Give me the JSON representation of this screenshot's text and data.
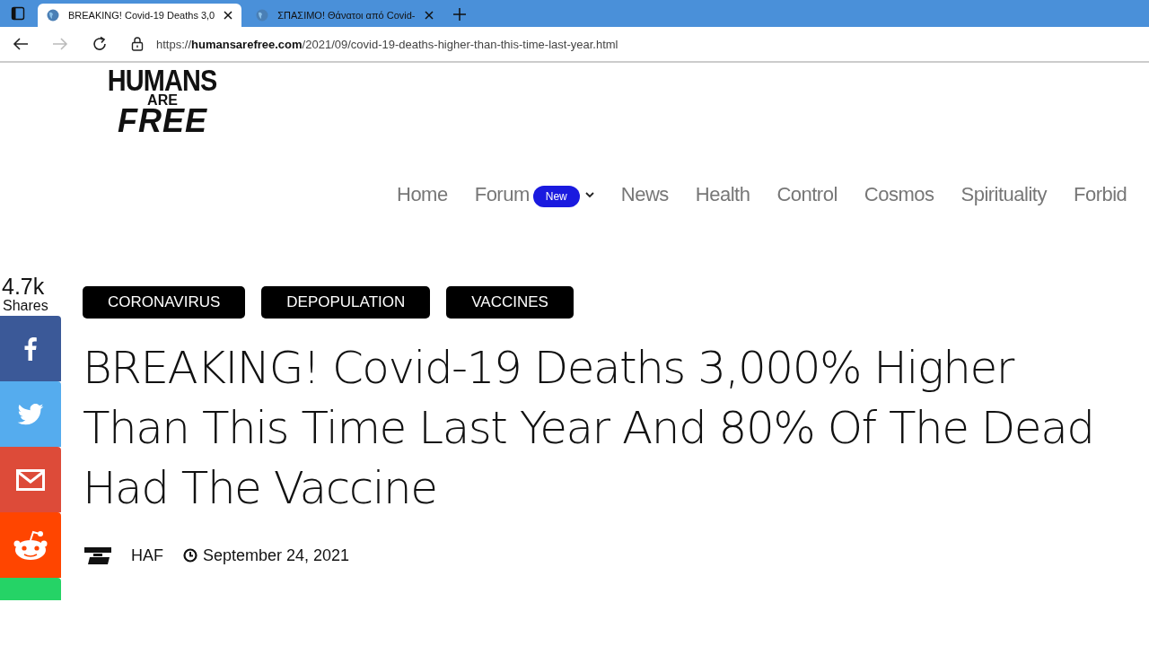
{
  "browser": {
    "tabs": [
      {
        "title": "BREAKING! Covid-19 Deaths 3,0",
        "selected": true
      },
      {
        "title": "ΣΠΑΣΙΜΟ! Θάνατοι από Covid-",
        "selected": false
      }
    ],
    "url": "https://**humansarefree.com**/2021/09/covid-19-deaths-higher-than-this-time-last-year.html"
  },
  "logo": {
    "line_1": "HUMANS",
    "line_2": "ARE",
    "line_3": "FREE"
  },
  "nav": [
    {
      "label": "Home"
    },
    {
      "label": "Forum",
      "badge": "New",
      "dropdown": true
    },
    {
      "label": "News"
    },
    {
      "label": "Health"
    },
    {
      "label": "Control"
    },
    {
      "label": "Cosmos"
    },
    {
      "label": "Spirituality"
    },
    {
      "label": "Forbid"
    }
  ],
  "share": {
    "count": "4.7k",
    "label": "Shares",
    "buttons": [
      {
        "kind": "facebook",
        "color": "#3b5998"
      },
      {
        "kind": "twitter",
        "color": "#55acee"
      },
      {
        "kind": "email",
        "color": "#dd4b39"
      },
      {
        "kind": "reddit",
        "color": "#ff4500"
      },
      {
        "kind": "whatsapp",
        "color": "#25d366"
      }
    ]
  },
  "tags": [
    "CORONAVIRUS",
    "DEPOPULATION",
    "VACCINES"
  ],
  "title": "BREAKING! Covid-19 Deaths 3,000% Higher Than This Time Last Year And 80% Of The Dead Had The Vaccine",
  "author": "HAF",
  "date": "September 24, 2021"
}
